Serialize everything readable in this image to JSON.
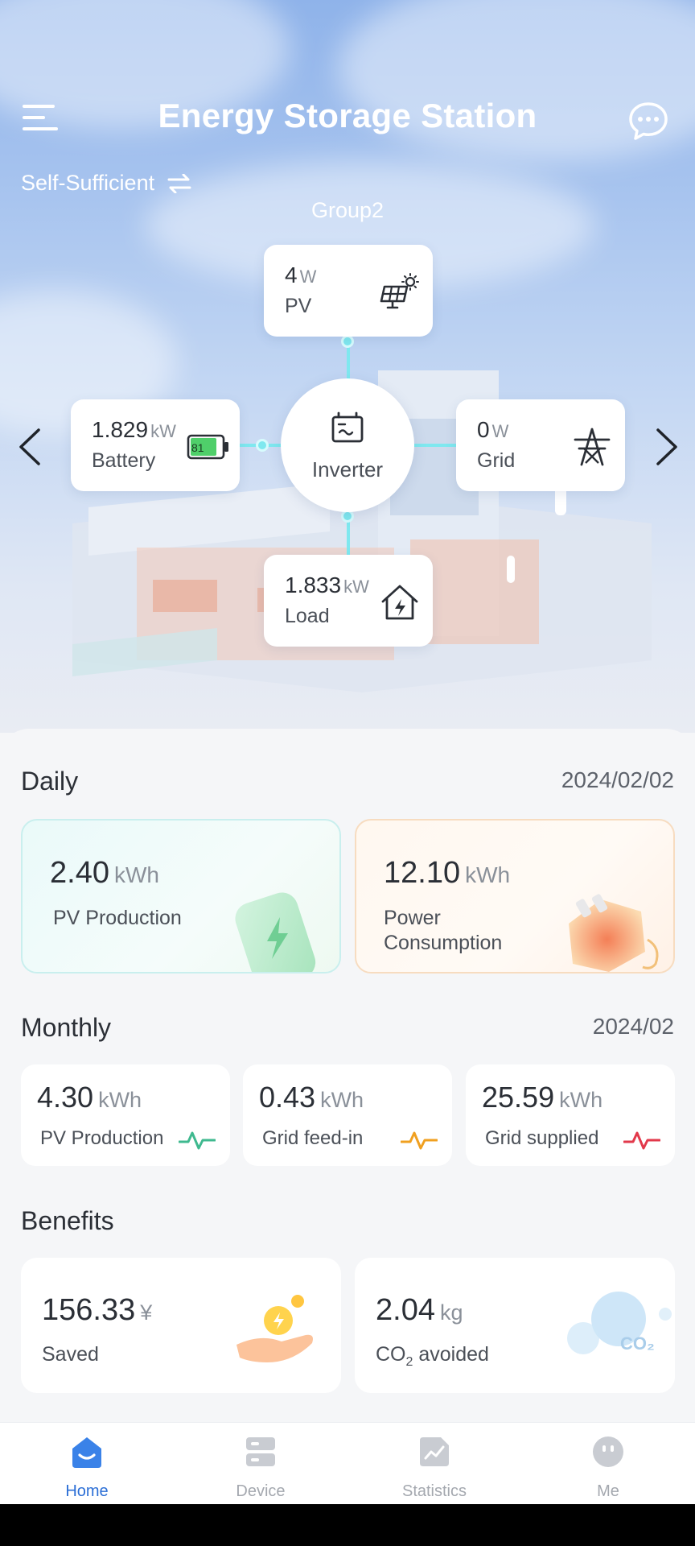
{
  "header": {
    "title": "Energy Storage Station",
    "menu_icon": "hamburger-menu-icon",
    "chat_icon": "chat-bubble-icon"
  },
  "mode": {
    "label": "Self-Sufficient",
    "icon": "swap-arrows-icon"
  },
  "group": {
    "name": "Group2"
  },
  "energy_flow": {
    "pv": {
      "value": "4",
      "unit": "W",
      "label": "PV",
      "icon": "solar-panel-icon"
    },
    "battery": {
      "value": "1.829",
      "unit": "kW",
      "label": "Battery",
      "soc": "81",
      "icon": "battery-icon"
    },
    "inverter": {
      "label": "Inverter",
      "icon": "inverter-icon"
    },
    "grid": {
      "value": "0",
      "unit": "W",
      "label": "Grid",
      "icon": "transmission-tower-icon"
    },
    "load": {
      "value": "1.833",
      "unit": "kW",
      "label": "Load",
      "icon": "house-bolt-icon"
    },
    "accent_color": "#7fe8ef"
  },
  "daily": {
    "title": "Daily",
    "date": "2024/02/02",
    "pv_production": {
      "value": "2.40",
      "unit": "kWh",
      "label": "PV Production"
    },
    "power_consumption": {
      "value": "12.10",
      "unit": "kWh",
      "label_line1": "Power",
      "label_line2": "Consumption"
    }
  },
  "monthly": {
    "title": "Monthly",
    "date": "2024/02",
    "items": [
      {
        "value": "4.30",
        "unit": "kWh",
        "label": "PV Production",
        "color": "#3fb98f"
      },
      {
        "value": "0.43",
        "unit": "kWh",
        "label": "Grid feed-in",
        "color": "#f0a020"
      },
      {
        "value": "25.59",
        "unit": "kWh",
        "label": "Grid supplied",
        "color": "#e2394b"
      }
    ]
  },
  "benefits": {
    "title": "Benefits",
    "saved": {
      "value": "156.33",
      "unit": "¥",
      "label": "Saved"
    },
    "co2": {
      "value": "2.04",
      "unit": "kg",
      "label_prefix": "CO",
      "label_sub": "2",
      "label_suffix": " avoided",
      "badge": "CO₂"
    }
  },
  "tabs": [
    {
      "label": "Home",
      "icon": "home-icon",
      "active": true
    },
    {
      "label": "Device",
      "icon": "device-icon",
      "active": false
    },
    {
      "label": "Statistics",
      "icon": "statistics-icon",
      "active": false
    },
    {
      "label": "Me",
      "icon": "profile-icon",
      "active": false
    }
  ],
  "colors": {
    "active_tab": "#2c6fd6",
    "inactive_tab": "#a4a8af"
  }
}
